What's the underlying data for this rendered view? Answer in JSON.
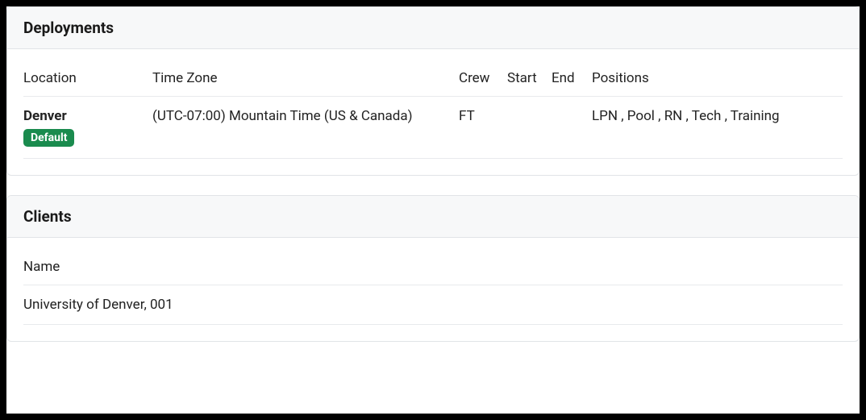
{
  "deployments": {
    "title": "Deployments",
    "columns": {
      "location": "Location",
      "timezone": "Time Zone",
      "crew": "Crew",
      "start": "Start",
      "end": "End",
      "positions": "Positions"
    },
    "rows": [
      {
        "location": "Denver",
        "badge": "Default",
        "timezone": "(UTC-07:00) Mountain Time (US & Canada)",
        "crew": "FT",
        "start": "",
        "end": "",
        "positions": "LPN , Pool , RN , Tech , Training"
      }
    ]
  },
  "clients": {
    "title": "Clients",
    "columns": {
      "name": "Name"
    },
    "rows": [
      {
        "name": "University of Denver, 001"
      }
    ]
  }
}
